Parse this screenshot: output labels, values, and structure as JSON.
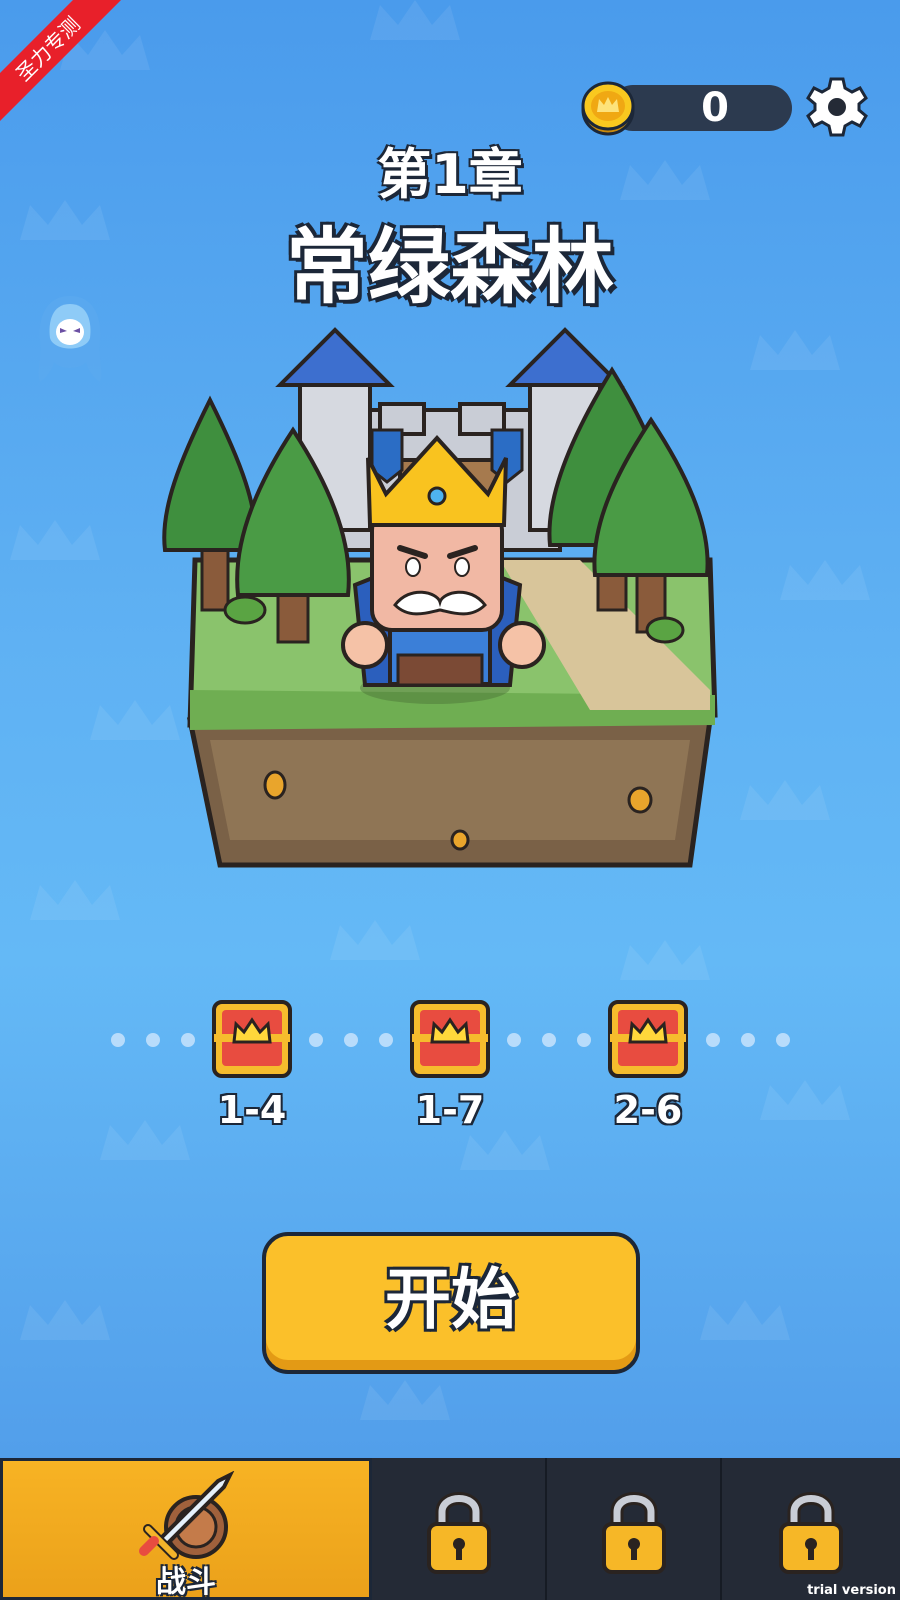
{
  "ribbon": {
    "label": "圣力专测"
  },
  "header": {
    "coins": "0"
  },
  "chapter": {
    "number_label": "第1章",
    "name": "常绿森林"
  },
  "milestones": [
    {
      "label": "1-4"
    },
    {
      "label": "1-7"
    },
    {
      "label": "2-6"
    }
  ],
  "start_button": {
    "label": "开始"
  },
  "nav": {
    "tabs": [
      {
        "label": "战斗",
        "icon": "sword-shield-icon",
        "active": true,
        "locked": false
      },
      {
        "label": "",
        "icon": "lock-icon",
        "active": false,
        "locked": true
      },
      {
        "label": "",
        "icon": "lock-icon",
        "active": false,
        "locked": true
      },
      {
        "label": "",
        "icon": "lock-icon",
        "active": false,
        "locked": true
      }
    ]
  },
  "watermark": "trial version",
  "colors": {
    "background": "#5fb1f3",
    "coin_bar": "#2c3a4f",
    "start_button": "#fbc02a",
    "nav_active": "#f7b324",
    "nav_bg": "#242a36",
    "ribbon": "#e8202a"
  }
}
